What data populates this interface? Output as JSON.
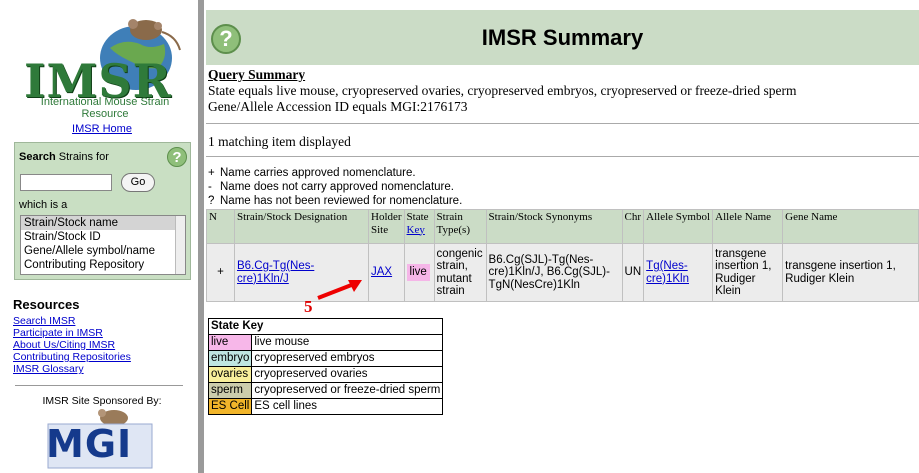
{
  "sidebar": {
    "logo_text": "IMSR",
    "tagline_line1": "International Mouse Strain",
    "tagline_line2": "Resource",
    "home_link": "IMSR Home",
    "search": {
      "label_bold": "Search",
      "label_rest": " Strains for",
      "go_label": "Go",
      "which_label": "which is a",
      "options": [
        "Strain/Stock name",
        "Strain/Stock ID",
        "Gene/Allele symbol/name",
        "Contributing Repository"
      ],
      "selected": "Strain/Stock name"
    },
    "resources_title": "Resources",
    "resources_links": [
      "Search IMSR",
      "Participate in IMSR",
      "About Us/Citing IMSR",
      "Contributing Repositories",
      "IMSR Glossary"
    ],
    "sponsor_text": "IMSR Site Sponsored By:",
    "sponsor_logo_text": "MGI"
  },
  "header": {
    "title": "IMSR Summary",
    "help_icon": "question-icon"
  },
  "query_summary": {
    "title": "Query Summary",
    "line1": "State equals live mouse, cryopreserved ovaries, cryopreserved embryos, cryopreserved or freeze-dried sperm",
    "line2": "Gene/Allele Accession ID equals MGI:2176173"
  },
  "count_text": "1 matching item displayed",
  "legend": [
    {
      "symbol": "+",
      "text": "Name carries approved nomenclature."
    },
    {
      "symbol": "-",
      "text": "Name does not carry approved nomenclature."
    },
    {
      "symbol": "?",
      "text": "Name has not been reviewed for nomenclature."
    }
  ],
  "results": {
    "headers": {
      "n": "N",
      "designation": "Strain/Stock Designation",
      "holder": "Holder Site",
      "state": "State",
      "state_key_link": "Key",
      "strain_type": "Strain Type(s)",
      "synonyms": "Strain/Stock Synonyms",
      "chr": "Chr",
      "allele_symbol": "Allele Symbol",
      "allele_name": "Allele Name",
      "gene_name": "Gene Name"
    },
    "rows": [
      {
        "n": "+",
        "designation": "B6.Cg-Tg(Nes-cre)1Kln/J",
        "holder": "JAX",
        "state": "live",
        "strain_type": "congenic strain, mutant strain",
        "synonyms": "B6.Cg(SJL)-Tg(Nes-cre)1Kln/J, B6.Cg(SJL)-TgN(NesCre)1Kln",
        "chr": "UN",
        "allele_symbol": "Tg(Nes-cre)1Kln",
        "allele_name": "transgene insertion 1, Rudiger Klein",
        "gene_name": "transgene insertion 1, Rudiger Klein"
      }
    ]
  },
  "annotation_number": "5",
  "state_key": {
    "title": "State Key",
    "items": [
      {
        "code": "live",
        "desc": "live mouse"
      },
      {
        "code": "embryo",
        "desc": "cryopreserved embryos"
      },
      {
        "code": "ovaries",
        "desc": "cryopreserved ovaries"
      },
      {
        "code": "sperm",
        "desc": "cryopreserved or freeze-dried sperm"
      },
      {
        "code": "ES Cell",
        "desc": "ES cell lines"
      }
    ]
  },
  "colors": {
    "header_bg": "#cbdcc6",
    "link": "#0000cc",
    "logo_green": "#2f7a3a",
    "live": "#f7b7e9",
    "embryo": "#bfe6e1",
    "ovaries": "#f8ef9b",
    "sperm": "#cccdab",
    "es_cell": "#f1b52a"
  }
}
